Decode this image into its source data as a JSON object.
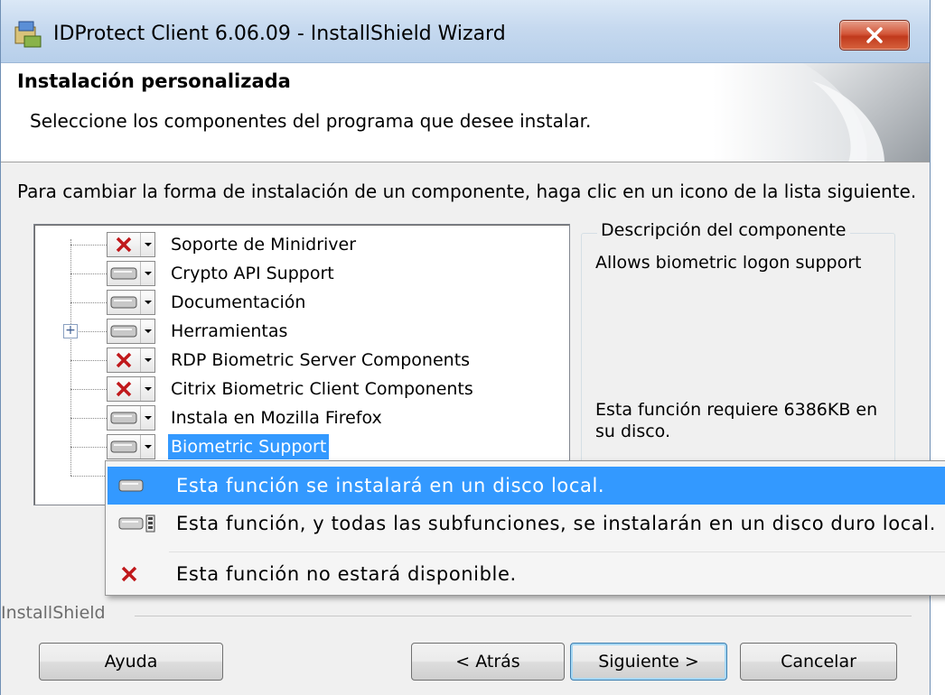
{
  "window": {
    "title": "IDProtect Client 6.06.09 - InstallShield Wizard"
  },
  "header": {
    "title": "Instalación personalizada",
    "subtitle": "Seleccione los componentes del programa que desee instalar."
  },
  "instruction": "Para cambiar la forma de instalación de un componente, haga clic en un icono de la lista siguiente.",
  "tree": {
    "items": [
      {
        "label": "Soporte de Minidriver",
        "icon": "x-icon"
      },
      {
        "label": "Crypto API Support",
        "icon": "drive-icon"
      },
      {
        "label": "Documentación",
        "icon": "drive-icon"
      },
      {
        "label": "Herramientas",
        "icon": "drive-icon",
        "expandable": true
      },
      {
        "label": "RDP Biometric Server Components",
        "icon": "x-icon"
      },
      {
        "label": "Citrix Biometric Client Components",
        "icon": "x-icon"
      },
      {
        "label": "Instala en Mozilla Firefox",
        "icon": "drive-icon"
      },
      {
        "label": "Biometric Support",
        "icon": "drive-icon",
        "selected": true
      }
    ]
  },
  "description": {
    "legend": "Descripción del componente",
    "text": "Allows biometric logon support",
    "requirement": "Esta función requiere 6386KB en su disco."
  },
  "menu": {
    "items": [
      {
        "label": "Esta función se instalará en un disco local.",
        "icon": "drive-icon",
        "highlighted": true
      },
      {
        "label": "Esta función, y todas las subfunciones, se instalarán en un disco duro local.",
        "icon": "drive-subfeatures-icon"
      },
      {
        "label": "Esta función no estará disponible.",
        "icon": "x-icon"
      }
    ]
  },
  "footer": {
    "brand": "InstallShield",
    "help": "Ayuda",
    "back": "< Atrás",
    "next": "Siguiente >",
    "cancel": "Cancelar"
  },
  "colors": {
    "selection": "#3399ff",
    "x_red": "#c0181b",
    "close": "#c0391c"
  }
}
